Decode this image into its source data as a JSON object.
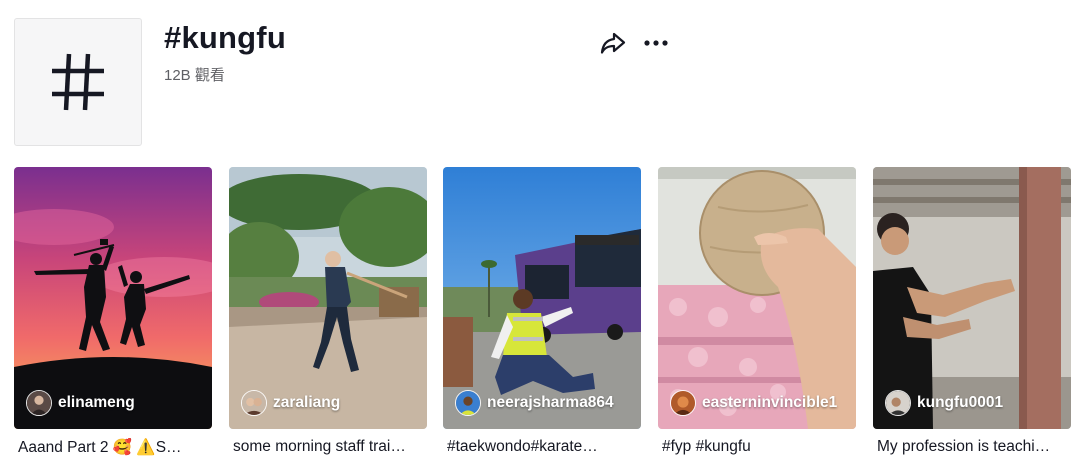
{
  "hashtag": {
    "icon": "hashtag-icon",
    "title": "#kungfu",
    "views": "12B 觀看"
  },
  "actions": {
    "share_icon": "share-icon",
    "more_icon": "more-options-icon"
  },
  "videos": [
    {
      "username": "elinameng",
      "caption": "Aaand Part 2 🥰 ⚠️S…"
    },
    {
      "username": "zaraliang",
      "caption": "some morning staff trai…"
    },
    {
      "username": "neerajsharma864",
      "caption": "#taekwondo#karate…"
    },
    {
      "username": "easterninvincible1",
      "caption": "#fyp #kungfu"
    },
    {
      "username": "kungfu0001",
      "caption": "My profession is teachi…"
    }
  ]
}
